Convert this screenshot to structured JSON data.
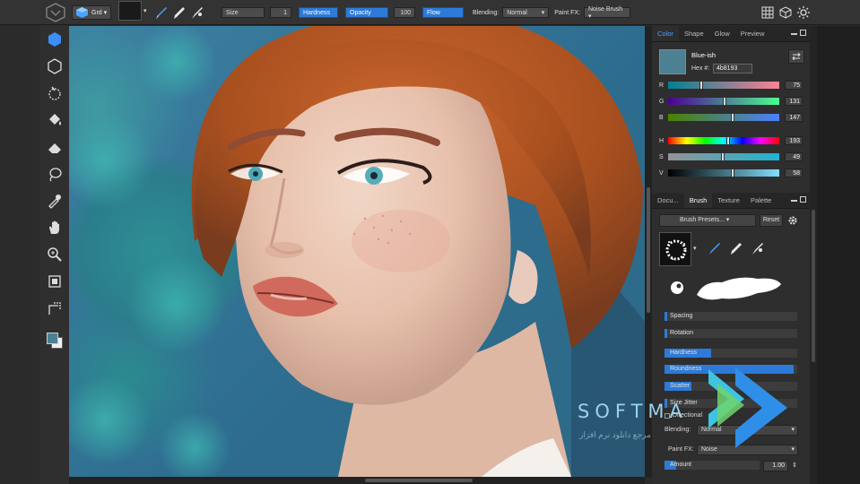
{
  "toolbar": {
    "grid_label": "Grd ▾",
    "size_label": "Size",
    "size_value": "1",
    "hardness_label": "Hardness",
    "opacity_label": "Opacity",
    "opacity_value": "100",
    "flow_label": "Flow",
    "blending_label": "Blending:",
    "blending_value": "Normal",
    "paint_fx_label": "Paint FX:",
    "paint_fx_value": "Noise Brush ▾"
  },
  "color_panel": {
    "tabs": [
      "Color",
      "Shape",
      "Glow",
      "Preview"
    ],
    "swatch_color": "#4b8193",
    "color_name": "Blue-ish",
    "hex_label": "Hex #:",
    "hex_value": "4b8193",
    "channels": [
      {
        "label": "R",
        "value": "75",
        "fraction": 0.29
      },
      {
        "label": "G",
        "value": "131",
        "fraction": 0.51
      },
      {
        "label": "B",
        "value": "147",
        "fraction": 0.58
      },
      {
        "label": "H",
        "value": "193",
        "fraction": 0.54
      },
      {
        "label": "S",
        "value": "49",
        "fraction": 0.49
      },
      {
        "label": "V",
        "value": "58",
        "fraction": 0.58
      }
    ]
  },
  "brush_panel": {
    "tabs": [
      "Docu...",
      "Brush",
      "Texture",
      "Palette"
    ],
    "presets_label": "Brush Presets... ▾",
    "reset_label": "Reset",
    "properties": [
      {
        "label": "Spacing",
        "fraction": 0.02
      },
      {
        "label": "Rotation",
        "fraction": 0.02
      },
      {
        "label": "Hardness",
        "fraction": 0.35
      },
      {
        "label": "Roundness",
        "fraction": 0.97
      },
      {
        "label": "Scatter",
        "fraction": 0.2
      },
      {
        "label": "Size Jitter",
        "fraction": 0.02
      }
    ],
    "directional_label": "Directional",
    "blending_label": "Blending:",
    "blending_value": "Normal",
    "paint_fx_label": "Paint FX:",
    "paint_fx_value": "Noise",
    "amount_label": "Amount",
    "amount_value": "1.00",
    "amount_fraction": 0.12
  },
  "watermark": {
    "brand": "SOFTMA",
    "subtitle": "مرجع دانلود نرم افزار"
  }
}
